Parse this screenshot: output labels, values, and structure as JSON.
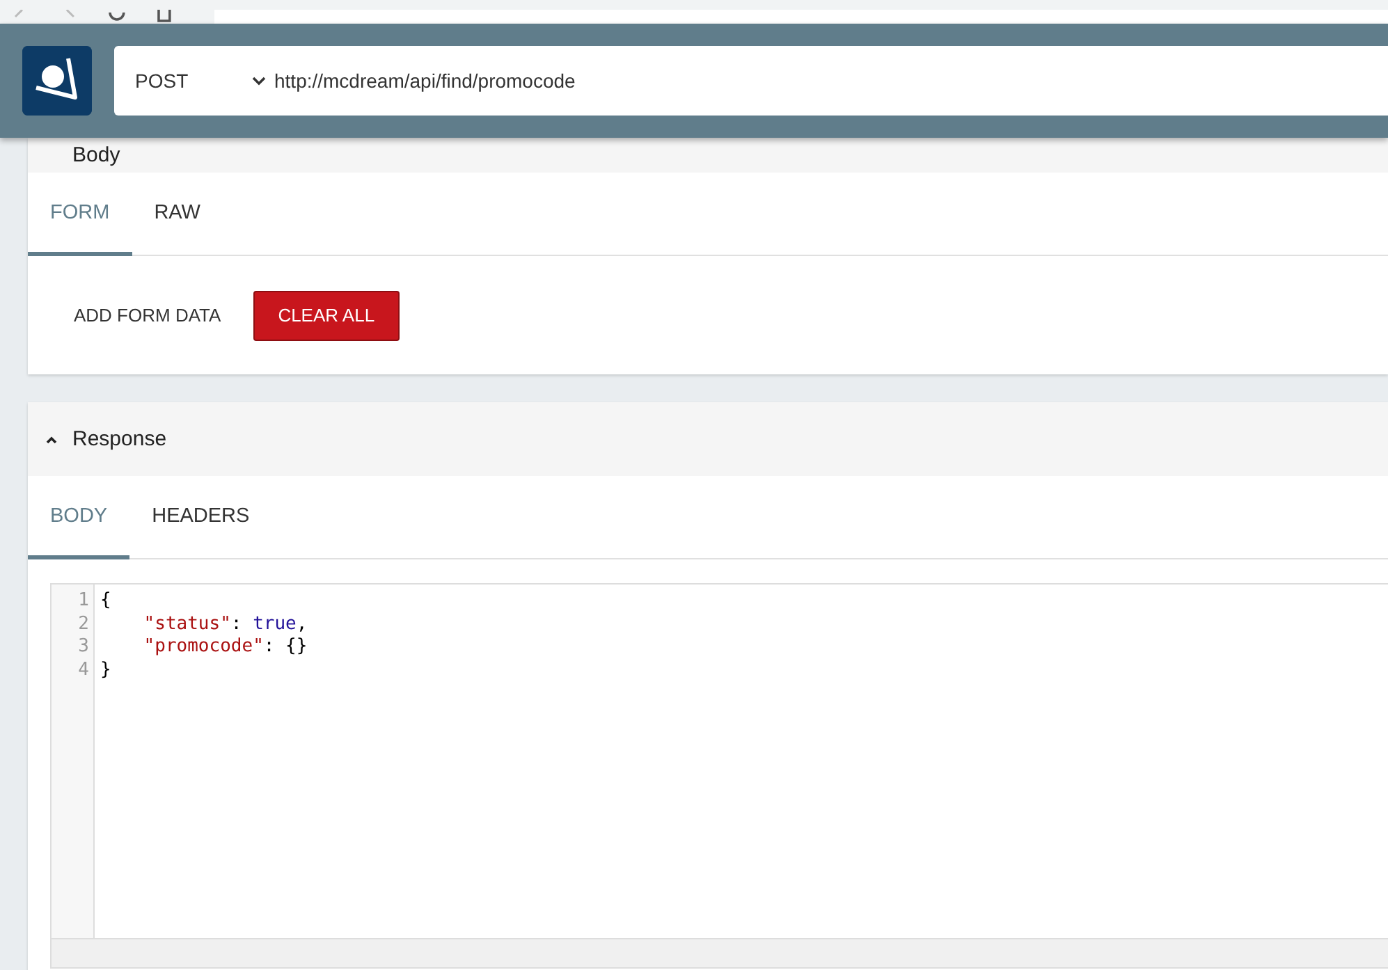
{
  "request": {
    "method": "POST",
    "url": "http://mcdream/api/find/promocode"
  },
  "body": {
    "title": "Body",
    "tabs": [
      {
        "label": "FORM",
        "selected": true
      },
      {
        "label": "RAW",
        "selected": false
      }
    ],
    "buttons": [
      {
        "label": "ADD FORM DATA",
        "kind": "flat"
      },
      {
        "label": "CLEAR ALL",
        "kind": "danger"
      }
    ]
  },
  "response": {
    "title": "Response",
    "expanded": true,
    "tabs": [
      {
        "label": "BODY",
        "selected": true
      },
      {
        "label": "HEADERS",
        "selected": false
      }
    ],
    "code": [
      {
        "number": "1",
        "indented": false,
        "tokens": [
          {
            "text": "{",
            "kind": "plain"
          }
        ]
      },
      {
        "number": "2",
        "indented": true,
        "tokens": [
          {
            "text": "\"status\"",
            "kind": "key"
          },
          {
            "text": ": ",
            "kind": "plain"
          },
          {
            "text": "true",
            "kind": "atom"
          },
          {
            "text": ",",
            "kind": "plain"
          }
        ]
      },
      {
        "number": "3",
        "indented": true,
        "tokens": [
          {
            "text": "\"promocode\"",
            "kind": "key"
          },
          {
            "text": ": {}",
            "kind": "plain"
          }
        ]
      },
      {
        "number": "4",
        "indented": false,
        "tokens": [
          {
            "text": "}",
            "kind": "plain"
          }
        ]
      }
    ]
  }
}
